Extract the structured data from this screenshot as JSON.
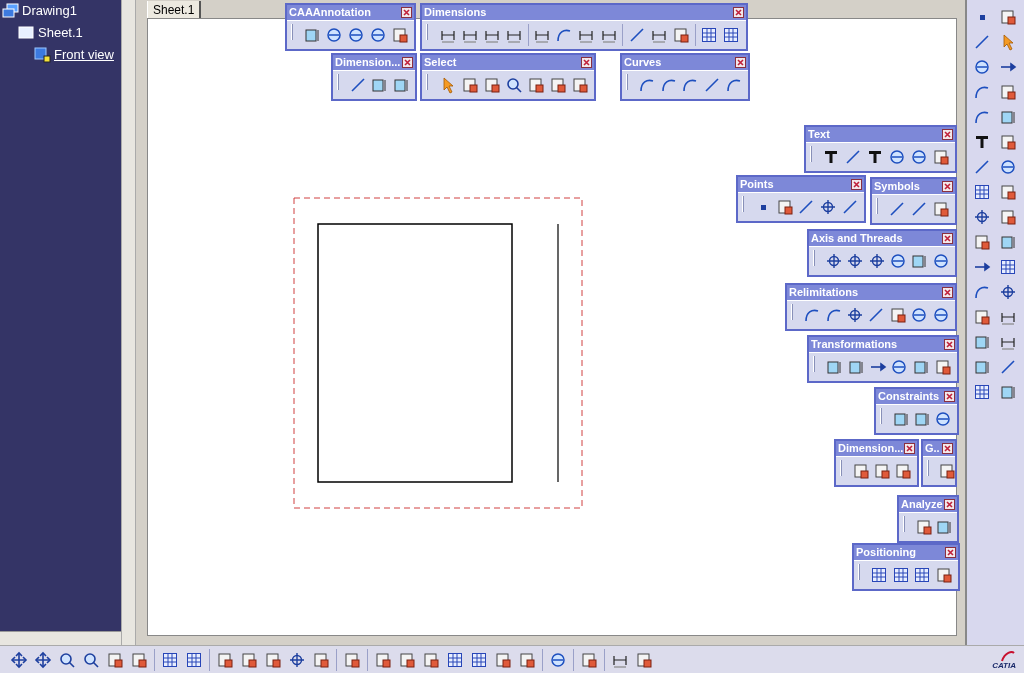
{
  "tree": {
    "label": "Drawing1",
    "selected": false,
    "children": [
      {
        "label": "Sheet.1",
        "selected": false,
        "children": [
          {
            "label": "Front view",
            "selected": true
          }
        ]
      }
    ]
  },
  "tabs": [
    {
      "label": "Sheet.1",
      "selected": true
    }
  ],
  "toolbars": [
    {
      "title": "CAAAnnotation"
    },
    {
      "title": "Dimensions"
    },
    {
      "title": "Dimension..."
    },
    {
      "title": "Select"
    },
    {
      "title": "Curves"
    },
    {
      "title": "Text"
    },
    {
      "title": "Points"
    },
    {
      "title": "Symbols"
    },
    {
      "title": "Axis and Threads"
    },
    {
      "title": "Relimitations"
    },
    {
      "title": "Transformations"
    },
    {
      "title": "Constraints"
    },
    {
      "title": "Dimension..."
    },
    {
      "title": "G.."
    },
    {
      "title": "Analyze"
    },
    {
      "title": "Positioning"
    }
  ],
  "logo": {
    "text": "CATIA"
  }
}
